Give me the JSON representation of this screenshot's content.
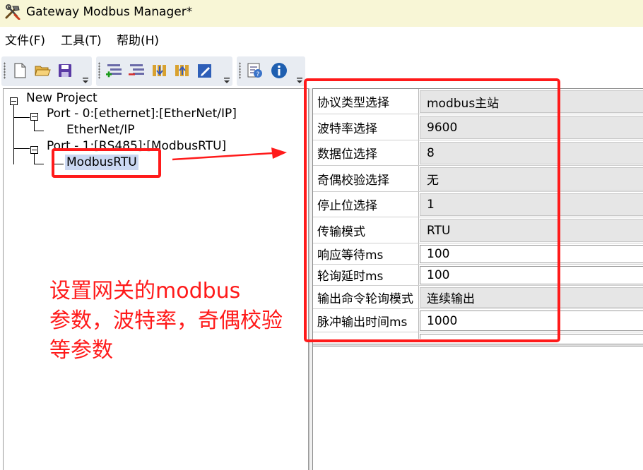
{
  "window": {
    "title": "Gateway Modbus Manager*"
  },
  "menu": [
    {
      "label": "文件(F)"
    },
    {
      "label": "工具(T)"
    },
    {
      "label": "帮助(H)"
    }
  ],
  "toolbar": {
    "groups": [
      [
        "new-file-icon",
        "open-folder-icon",
        "save-icon"
      ],
      [
        "add-port-icon",
        "remove-port-icon",
        "import-icon",
        "export-icon",
        "edit-config-icon"
      ],
      [
        "help-icon",
        "info-icon"
      ]
    ]
  },
  "tree": {
    "root": "New Project",
    "ports": [
      {
        "label": "Port - 0:[ethernet]:[EtherNet/IP]",
        "child": "EtherNet/IP"
      },
      {
        "label": "Port - 1:[RS485]:[ModbusRTU]",
        "child": "ModbusRTU",
        "selected": true
      }
    ]
  },
  "properties": [
    {
      "name": "协议类型选择",
      "value": "modbus主站",
      "kind": "combo"
    },
    {
      "name": "波特率选择",
      "value": "9600",
      "kind": "combo"
    },
    {
      "name": "数据位选择",
      "value": "8",
      "kind": "combo"
    },
    {
      "name": "奇偶校验选择",
      "value": "无",
      "kind": "combo"
    },
    {
      "name": "停止位选择",
      "value": "1",
      "kind": "combo"
    },
    {
      "name": "传输模式",
      "value": "RTU",
      "kind": "combo"
    },
    {
      "name": "响应等待ms",
      "value": "100",
      "kind": "text"
    },
    {
      "name": "轮询延时ms",
      "value": "100",
      "kind": "text"
    },
    {
      "name": "输出命令轮询模式",
      "value": "连续输出",
      "kind": "combo"
    },
    {
      "name": "脉冲输出时间ms",
      "value": "1000",
      "kind": "text"
    },
    {
      "name": "",
      "value": "",
      "kind": "text"
    }
  ],
  "annotation": {
    "lines": [
      "设置网关的modbus",
      "参数，波特率，奇偶校验",
      "等参数"
    ],
    "color": "#ff1a1a"
  },
  "colors": {
    "titlebar": "#f8f6d6",
    "selection": "#cbd8f2",
    "combo_bg": "#e6e6e6"
  }
}
